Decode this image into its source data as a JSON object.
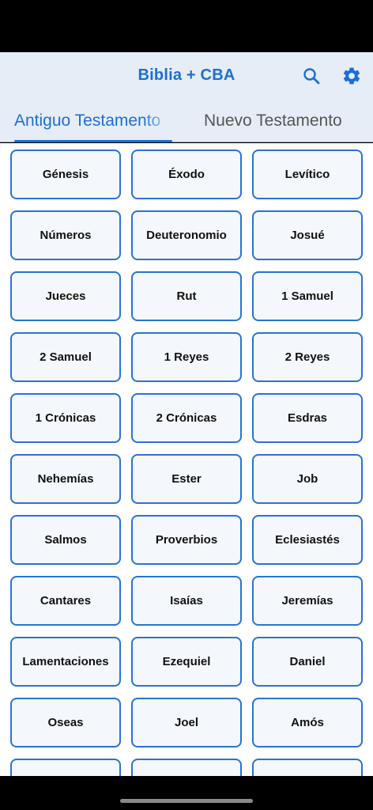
{
  "header": {
    "title": "Biblia + CBA",
    "icons": {
      "search": "search-icon",
      "settings": "gear-icon"
    },
    "accent_color": "#1a6fd6"
  },
  "tabs": [
    {
      "label": "Antiguo Testamento",
      "selected": true
    },
    {
      "label": "Nuevo Testamento",
      "selected": false
    }
  ],
  "books": [
    "Génesis",
    "Éxodo",
    "Levítico",
    "Números",
    "Deuteronomio",
    "Josué",
    "Jueces",
    "Rut",
    "1 Samuel",
    "2 Samuel",
    "1 Reyes",
    "2 Reyes",
    "1 Crónicas",
    "2 Crónicas",
    "Esdras",
    "Nehemías",
    "Ester",
    "Job",
    "Salmos",
    "Proverbios",
    "Eclesiastés",
    "Cantares",
    "Isaías",
    "Jeremías",
    "Lamentaciones",
    "Ezequiel",
    "Daniel",
    "Oseas",
    "Joel",
    "Amós",
    "",
    "",
    ""
  ]
}
